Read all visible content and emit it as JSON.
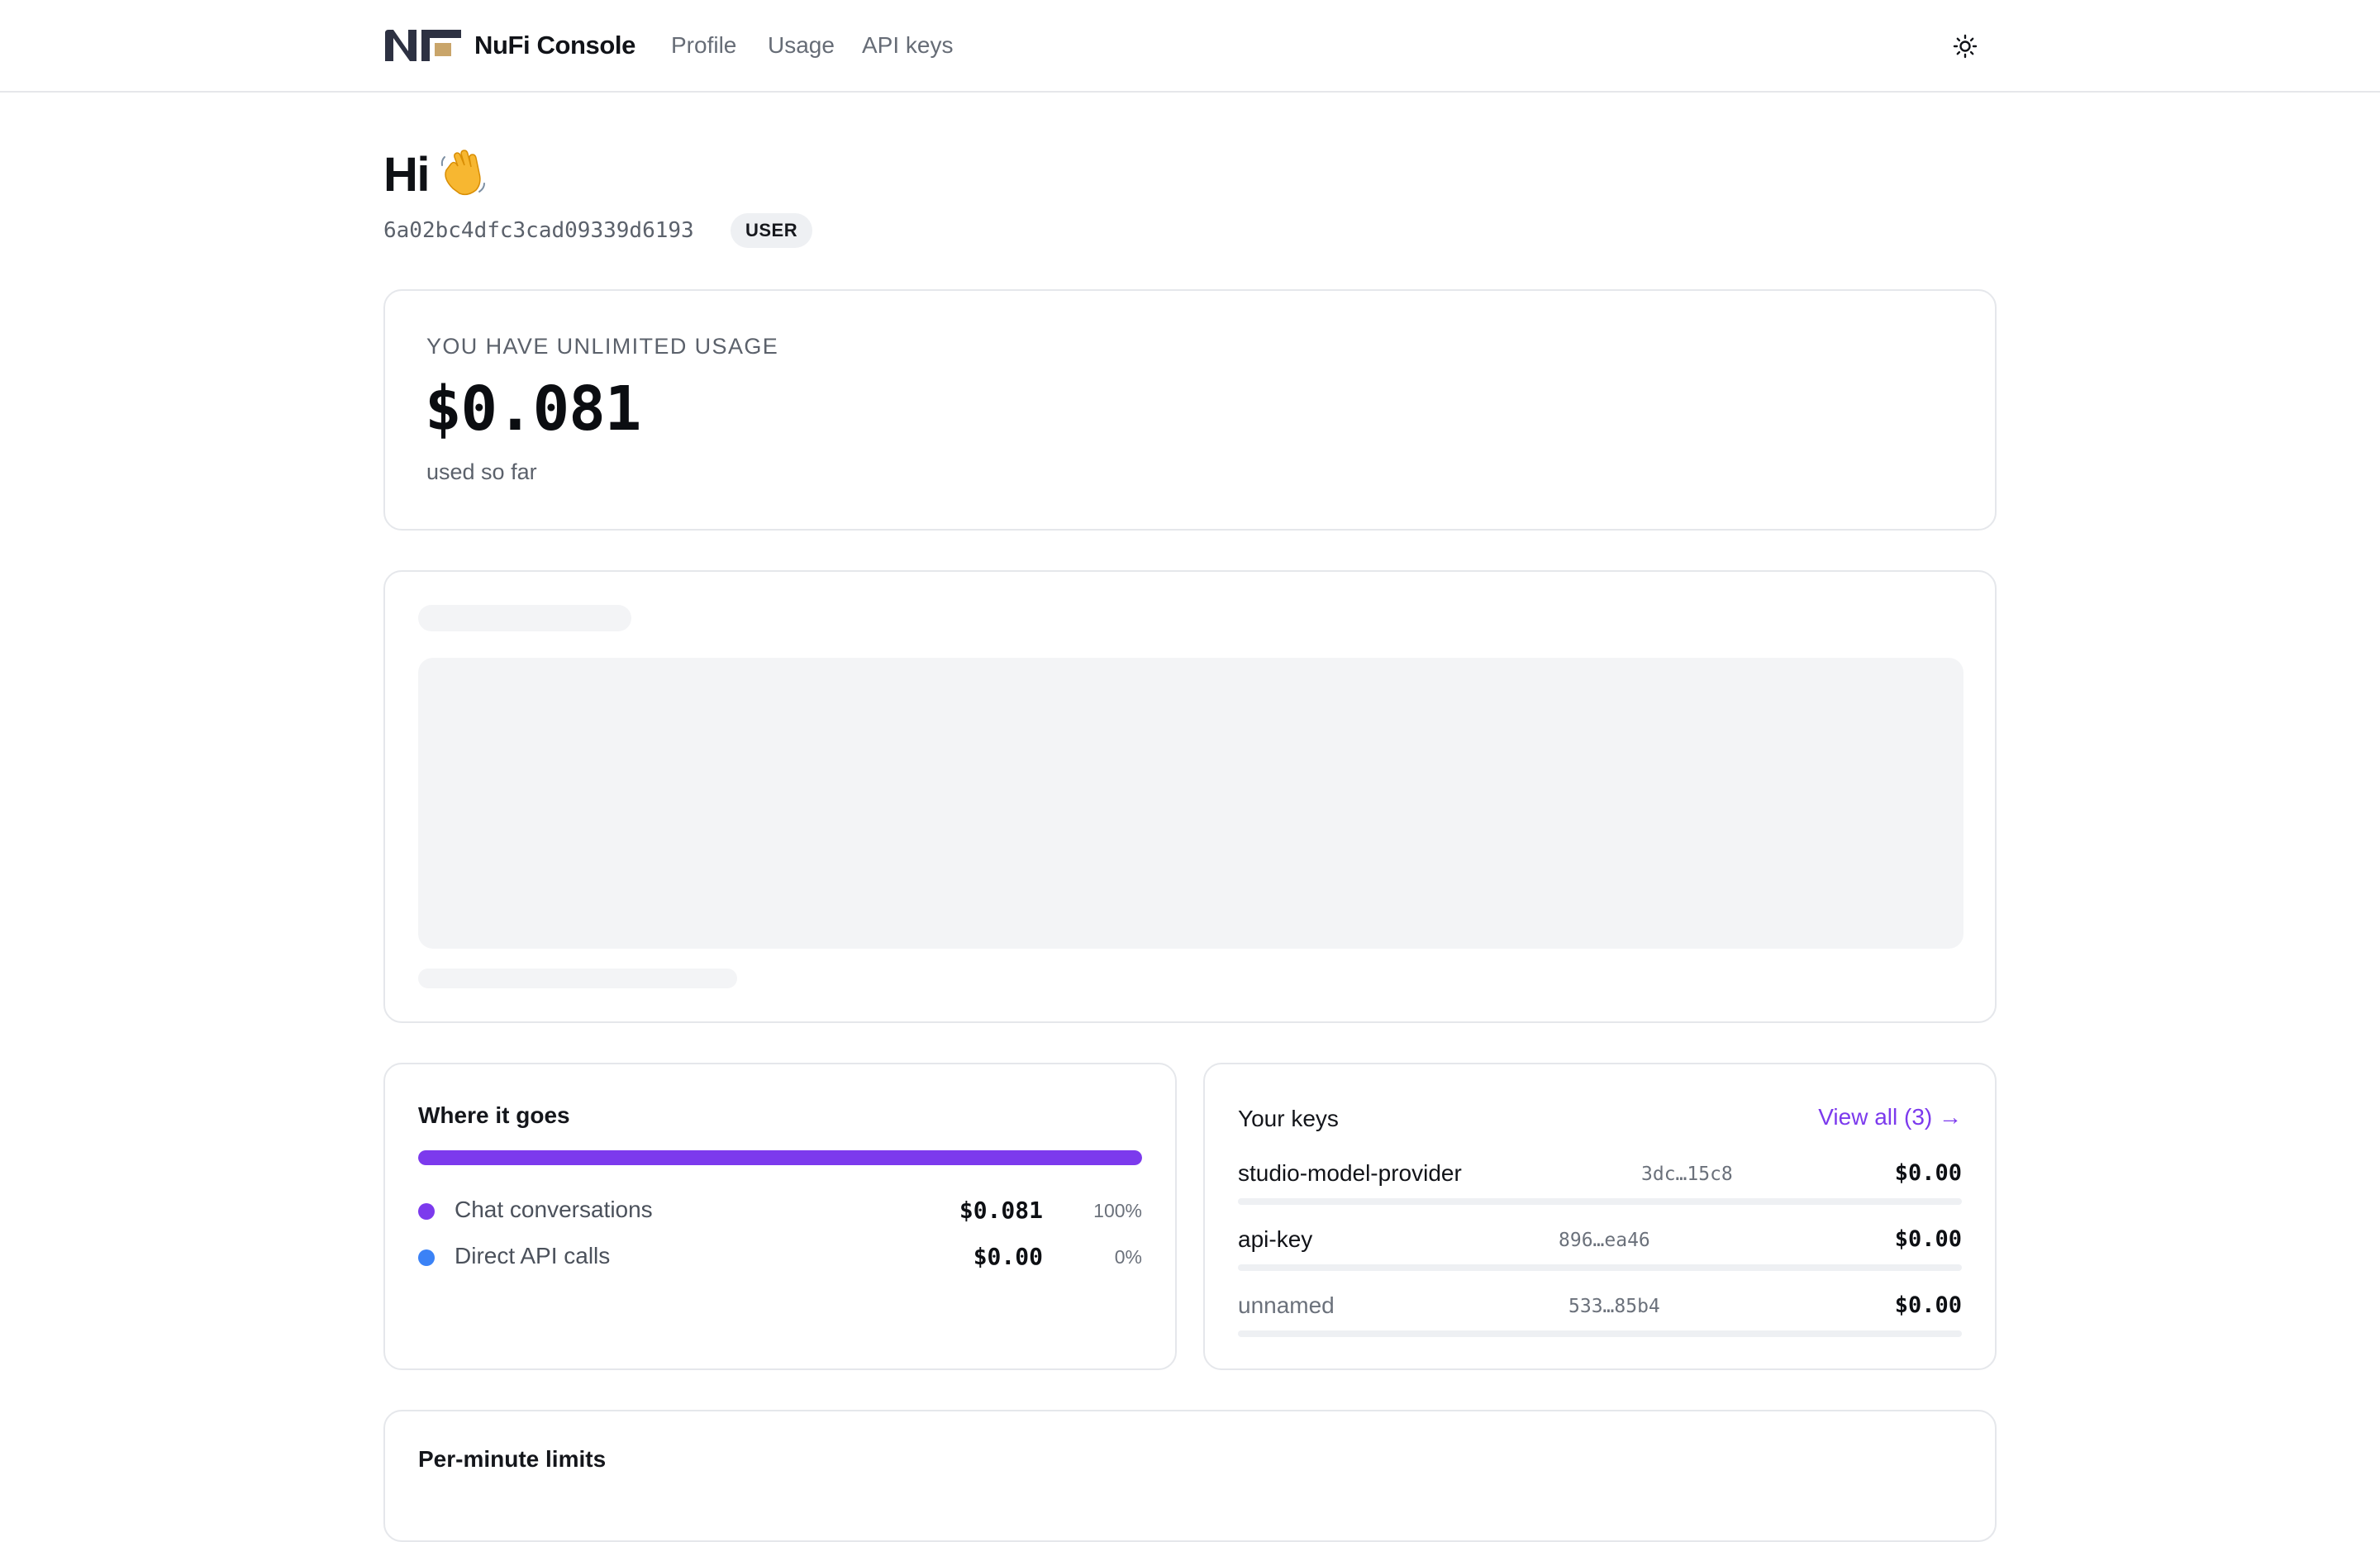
{
  "header": {
    "brand": "NuFi Console",
    "nav": [
      "Profile",
      "Usage",
      "API keys"
    ],
    "theme_icon": "sun-icon"
  },
  "greeting": {
    "title": "Hi",
    "emoji": "waving-hand-icon",
    "user_id": "6a02bc4dfc3cad09339d6193",
    "role": "USER"
  },
  "usage": {
    "caption": "YOU HAVE UNLIMITED USAGE",
    "amount": "$0.081",
    "subtitle": "used so far"
  },
  "breakdown": {
    "title": "Where it goes",
    "accent": "#7c3aed",
    "items": [
      {
        "label": "Chat conversations",
        "amount": "$0.081",
        "pct": "100%",
        "color": "#7c3aed",
        "share": 1.0
      },
      {
        "label": "Direct API calls",
        "amount": "$0.00",
        "pct": "0%",
        "color": "#3b82f6",
        "share": 0.0
      }
    ]
  },
  "keys": {
    "title": "Your keys",
    "view_all": "View all (3) →",
    "items": [
      {
        "name": "studio-model-provider",
        "hash": "3dc…15c8",
        "cost": "$0.00"
      },
      {
        "name": "api-key",
        "hash": "896…ea46",
        "cost": "$0.00"
      },
      {
        "name": "unnamed",
        "hash": "533…85b4",
        "cost": "$0.00"
      }
    ]
  },
  "limits": {
    "title": "Per-minute limits"
  }
}
